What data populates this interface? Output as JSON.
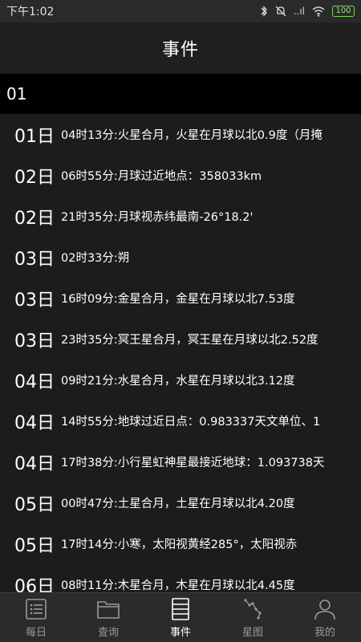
{
  "status_bar": {
    "time": "下午1:02",
    "signal": "..ıl",
    "battery": "100"
  },
  "header": {
    "title": "事件"
  },
  "month": {
    "label": "01"
  },
  "events": [
    {
      "day": "01日",
      "time": "04时13分:",
      "desc": "火星合月，火星在月球以北0.9度（月掩"
    },
    {
      "day": "02日",
      "time": "06时55分:",
      "desc": "月球过近地点：358033km"
    },
    {
      "day": "02日",
      "time": "21时35分:",
      "desc": "月球视赤纬最南-26°18.2'"
    },
    {
      "day": "03日",
      "time": "02时33分:",
      "desc": "朔"
    },
    {
      "day": "03日",
      "time": "16时09分:",
      "desc": "金星合月，金星在月球以北7.53度"
    },
    {
      "day": "03日",
      "time": "23时35分:",
      "desc": "冥王星合月，冥王星在月球以北2.52度"
    },
    {
      "day": "04日",
      "time": "09时21分:",
      "desc": "水星合月，水星在月球以北3.12度"
    },
    {
      "day": "04日",
      "time": "14时55分:",
      "desc": "地球过近日点：0.983337天文单位、1"
    },
    {
      "day": "04日",
      "time": "17时38分:",
      "desc": "小行星虹神星最接近地球：1.093738天"
    },
    {
      "day": "05日",
      "time": "00时47分:",
      "desc": "土星合月，土星在月球以北4.20度"
    },
    {
      "day": "05日",
      "time": "17时14分:",
      "desc": "小寒，太阳视黄经285°，太阳视赤"
    },
    {
      "day": "06日",
      "time": "08时11分:",
      "desc": "木星合月，木星在月球以北4.45度"
    }
  ],
  "tabs": [
    {
      "label": "每日",
      "icon": "list-icon",
      "active": false
    },
    {
      "label": "查询",
      "icon": "folder-icon",
      "active": false
    },
    {
      "label": "事件",
      "icon": "events-icon",
      "active": true
    },
    {
      "label": "星图",
      "icon": "constellation-icon",
      "active": false
    },
    {
      "label": "我的",
      "icon": "user-icon",
      "active": false
    }
  ]
}
